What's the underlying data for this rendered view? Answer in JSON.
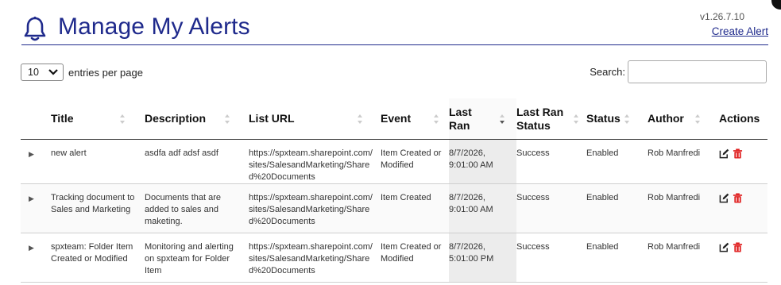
{
  "header": {
    "title": "Manage My Alerts",
    "version": "v1.26.7.10",
    "create_link": "Create Alert",
    "accent": "#1f2a8c"
  },
  "controls": {
    "page_size": "10",
    "entries_label": "entries per page",
    "search_label": "Search:",
    "search_value": ""
  },
  "table": {
    "columns": [
      "Title",
      "Description",
      "List URL",
      "Event",
      "Last Ran",
      "Last Ran Status",
      "Status",
      "Author",
      "Actions"
    ],
    "rows": [
      {
        "title": "new alert",
        "description": "asdfa adf adsf asdf",
        "list_url": "https://spxteam.sharepoint.com/sites/SalesandMarketing/Shared%20Documents",
        "event": "Item Created or Modified",
        "last_ran": "8/7/2026, 9:01:00 AM",
        "last_ran_status": "Success",
        "status": "Enabled",
        "author": "Rob Manfredi"
      },
      {
        "title": "Tracking document to Sales and Marketing",
        "description": "Documents that are added to sales and maketing.",
        "list_url": "https://spxteam.sharepoint.com/sites/SalesandMarketing/Shared%20Documents",
        "event": "Item Created",
        "last_ran": "8/7/2026, 9:01:00 AM",
        "last_ran_status": "Success",
        "status": "Enabled",
        "author": "Rob Manfredi"
      },
      {
        "title": "spxteam: Folder Item Created or Modified",
        "description": "Monitoring and alerting on spxteam for Folder Item",
        "list_url": "https://spxteam.sharepoint.com/sites/SalesandMarketing/Shared%20Documents",
        "event": "Item Created or Modified",
        "last_ran": "8/7/2026, 5:01:00 PM",
        "last_ran_status": "Success",
        "status": "Enabled",
        "author": "Rob Manfredi"
      }
    ]
  },
  "icons": {
    "bell": "bell-icon",
    "edit": "edit-icon",
    "delete": "trash-icon",
    "expand": "expand-arrow-icon",
    "delete_color": "#e02020"
  }
}
